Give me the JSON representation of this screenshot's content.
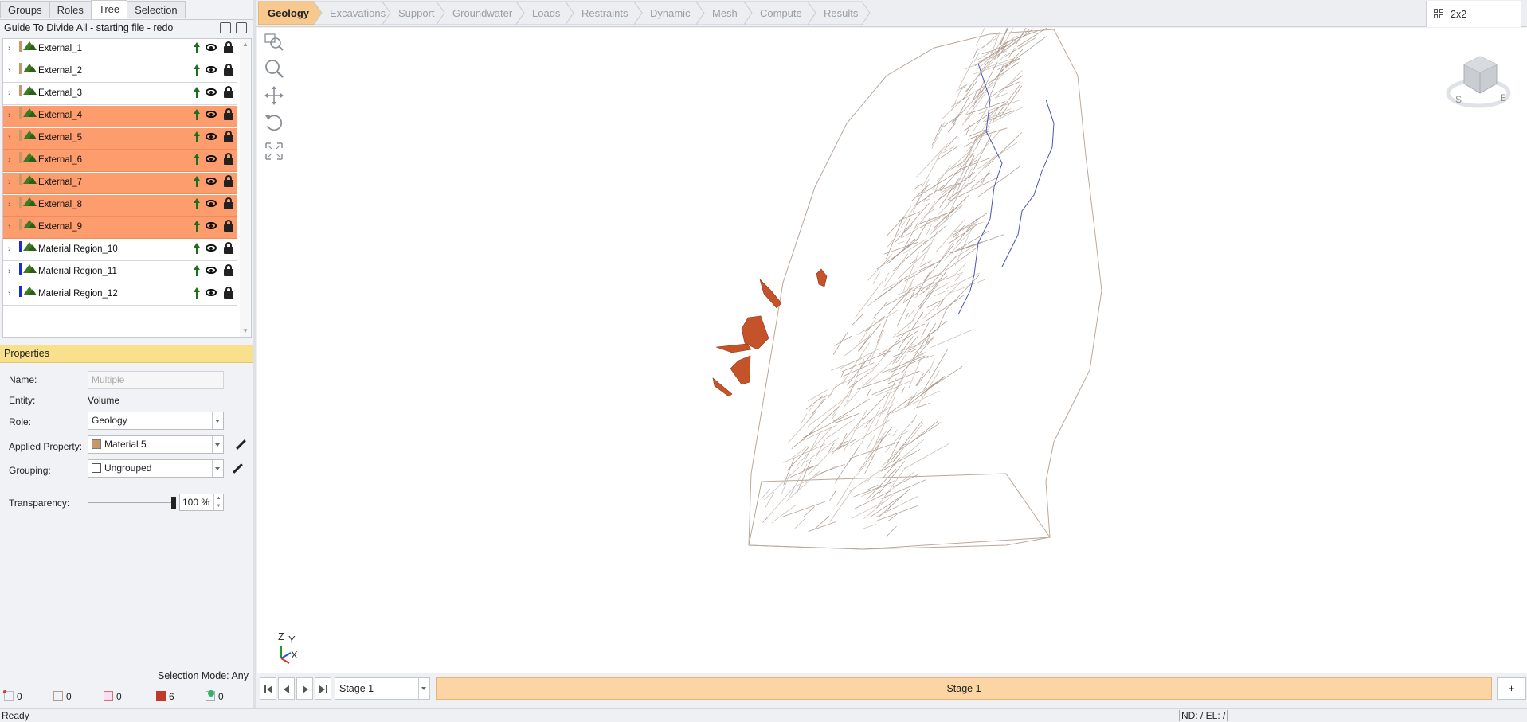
{
  "left_panel": {
    "tabs": [
      "Groups",
      "Roles",
      "Tree",
      "Selection"
    ],
    "active_tab": "Tree",
    "tree_title": "Guide To Divide All - starting file - redo",
    "tree_items": [
      {
        "label": "External_1",
        "swatch": "#c7976a",
        "selected": false
      },
      {
        "label": "External_2",
        "swatch": "#c7976a",
        "selected": false
      },
      {
        "label": "External_3",
        "swatch": "#c7976a",
        "selected": false
      },
      {
        "label": "External_4",
        "swatch": "#c7976a",
        "selected": true
      },
      {
        "label": "External_5",
        "swatch": "#c7976a",
        "selected": true
      },
      {
        "label": "External_6",
        "swatch": "#c7976a",
        "selected": true
      },
      {
        "label": "External_7",
        "swatch": "#c7976a",
        "selected": true
      },
      {
        "label": "External_8",
        "swatch": "#c7976a",
        "selected": true
      },
      {
        "label": "External_9",
        "swatch": "#c7976a",
        "selected": true
      },
      {
        "label": "Material Region_10",
        "swatch": "#1a2ed0",
        "selected": false
      },
      {
        "label": "Material Region_11",
        "swatch": "#1a2ed0",
        "selected": false
      },
      {
        "label": "Material Region_12",
        "swatch": "#1a2ed0",
        "selected": false
      }
    ]
  },
  "properties": {
    "header": "Properties",
    "name_label": "Name:",
    "name_placeholder": "Multiple",
    "entity_label": "Entity:",
    "entity_value": "Volume",
    "role_label": "Role:",
    "role_value": "Geology",
    "applied_property_label": "Applied Property:",
    "applied_property_value": "Material 5",
    "applied_property_color": "#c7976a",
    "grouping_label": "Grouping:",
    "grouping_value": "Ungrouped",
    "transparency_label": "Transparency:",
    "transparency_value": "100 %",
    "transparency_level": 1.0
  },
  "selection": {
    "mode_label": "Selection Mode:",
    "mode_value": "Any",
    "counts": [
      "0",
      "0",
      "0",
      "6",
      "0"
    ]
  },
  "workflow_tabs": [
    "Geology",
    "Excavations",
    "Support",
    "Groundwater",
    "Loads",
    "Restraints",
    "Dynamic",
    "Mesh",
    "Compute",
    "Results"
  ],
  "active_workflow_tab": "Geology",
  "layout_button": "2x2",
  "viewport": {
    "axis_labels": {
      "z": "Z",
      "y": "Y",
      "x": "X"
    },
    "viewcube_labels": {
      "s": "S",
      "e": "E"
    },
    "highlight_color": "#c4532a"
  },
  "stage": {
    "selected": "Stage 1",
    "current": "Stage 1",
    "add_label": "+"
  },
  "status": {
    "text": "Ready",
    "nd_el": "ND: /  EL: /"
  }
}
